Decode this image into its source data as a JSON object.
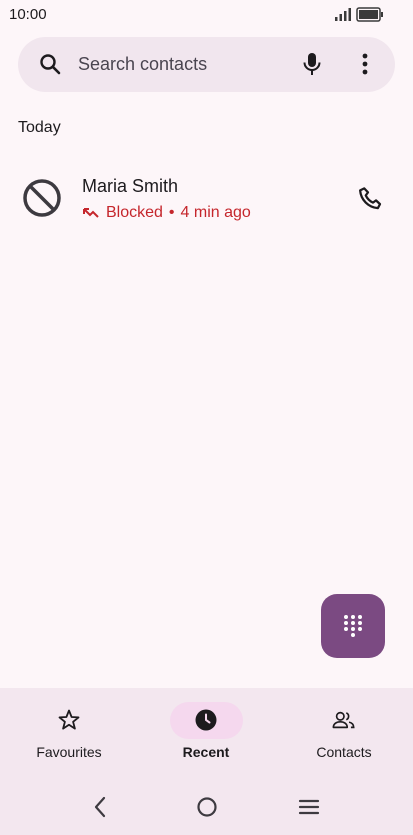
{
  "status_bar": {
    "time": "10:00"
  },
  "search": {
    "placeholder": "Search contacts"
  },
  "recents": {
    "section_heading": "Today",
    "calls": [
      {
        "name": "Maria Smith",
        "status": "Blocked",
        "separator": "•",
        "time_ago": "4 min ago"
      }
    ]
  },
  "bottom_nav": {
    "items": [
      {
        "label": "Favourites",
        "icon": "star-icon",
        "selected": false
      },
      {
        "label": "Recent",
        "icon": "clock-icon",
        "selected": true
      },
      {
        "label": "Contacts",
        "icon": "people-icon",
        "selected": false
      }
    ]
  },
  "colors": {
    "accent": "#7b4a82",
    "blocked": "#c5262c",
    "background": "#fdf6f9",
    "selected_pill": "#f5d8ee"
  }
}
